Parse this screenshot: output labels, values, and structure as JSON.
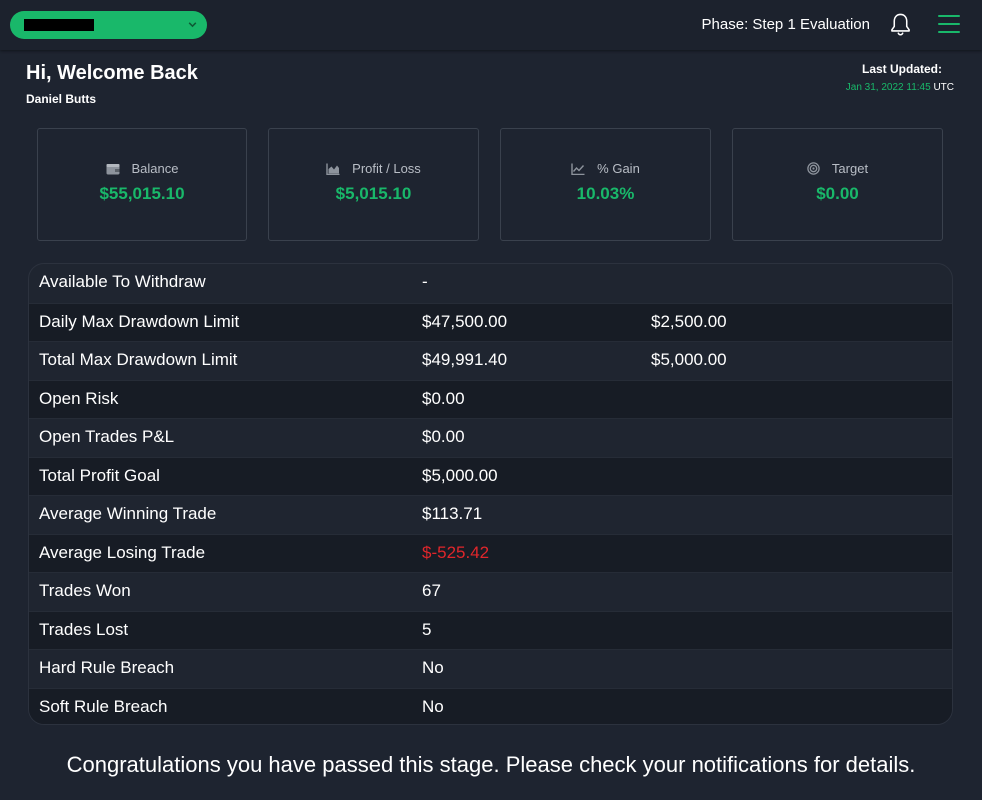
{
  "topbar": {
    "account_selector": {
      "selected": "",
      "chevron_icon": "chevron-down-icon",
      "color": "#19b86a"
    },
    "phase_text": "Phase: Step 1 Evaluation",
    "bell_icon": "bell-icon",
    "menu_icon": "hamburger-menu-icon"
  },
  "header": {
    "greeting": "Hi, Welcome Back",
    "user_name": "Daniel Butts",
    "last_updated_label": "Last Updated:",
    "last_updated_value": "Jan 31, 2022 11:45",
    "last_updated_tz": "UTC"
  },
  "cards": [
    {
      "label": "Balance",
      "value": "$55,015.10",
      "icon": "wallet-icon"
    },
    {
      "label": "Profit / Loss",
      "value": "$5,015.10",
      "icon": "area-chart-icon"
    },
    {
      "label": "% Gain",
      "value": "10.03%",
      "icon": "line-chart-icon"
    },
    {
      "label": "Target",
      "value": "$0.00",
      "icon": "target-icon"
    }
  ],
  "stats": [
    {
      "label": "Available To Withdraw",
      "value": "-",
      "extra": ""
    },
    {
      "label": "Daily Max Drawdown Limit",
      "value": "$47,500.00",
      "extra": "$2,500.00"
    },
    {
      "label": "Total Max Drawdown Limit",
      "value": "$49,991.40",
      "extra": "$5,000.00"
    },
    {
      "label": "Open Risk",
      "value": "$0.00",
      "extra": ""
    },
    {
      "label": "Open Trades P&L",
      "value": "$0.00",
      "extra": ""
    },
    {
      "label": "Total Profit Goal",
      "value": "$5,000.00",
      "extra": ""
    },
    {
      "label": "Average Winning Trade",
      "value": "$113.71",
      "extra": ""
    },
    {
      "label": "Average Losing Trade",
      "value": "$-525.42",
      "extra": ""
    },
    {
      "label": "Trades Won",
      "value": "67",
      "extra": ""
    },
    {
      "label": "Trades Lost",
      "value": "5",
      "extra": ""
    },
    {
      "label": "Hard Rule Breach",
      "value": "No",
      "extra": ""
    },
    {
      "label": "Soft Rule Breach",
      "value": "No",
      "extra": ""
    }
  ],
  "message": "Congratulations you have passed this stage. Please check your notifications for details.",
  "colors": {
    "accent": "#19b86a",
    "negative": "#e0262b",
    "background": "#1e2430"
  }
}
